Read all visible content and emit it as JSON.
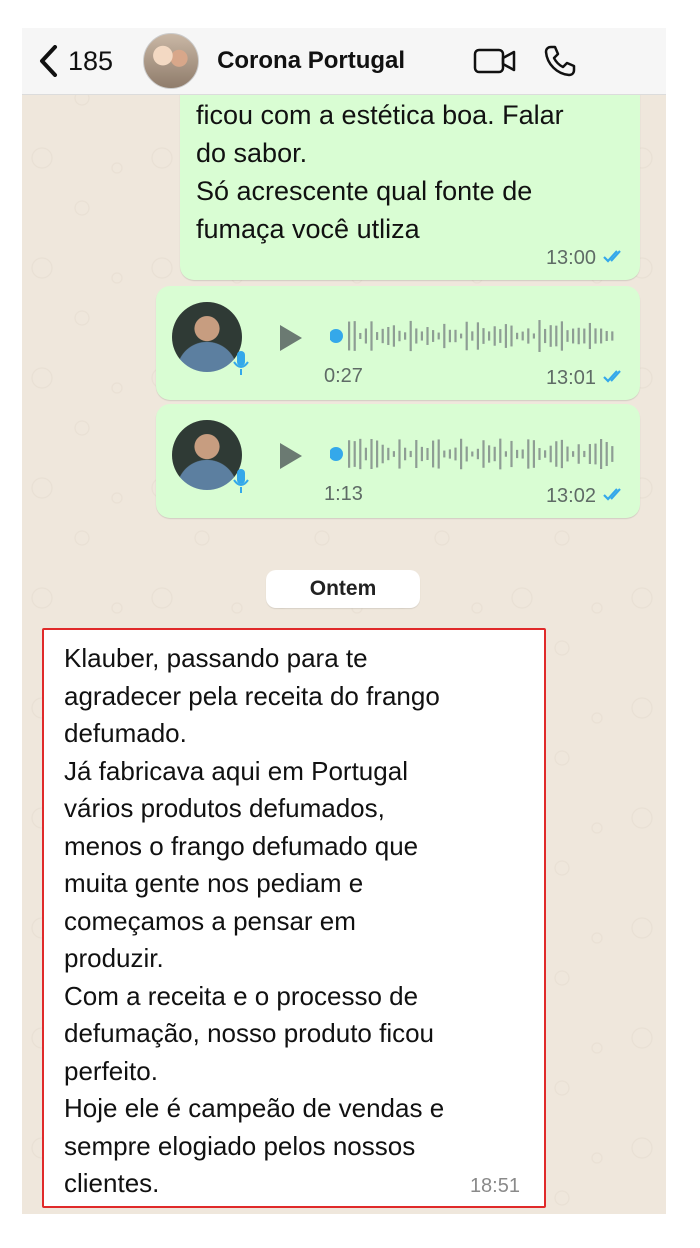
{
  "header": {
    "back_count": "185",
    "title": "Corona Portugal"
  },
  "messages": {
    "sent_text": {
      "text": "defumar deu certo e o produto\nficou com a estética boa. Falar\ndo sabor.\nSó acrescente qual fonte de\nfumaça você utliza",
      "time": "13:00"
    },
    "voice1": {
      "duration": "0:27",
      "time": "13:01"
    },
    "voice2": {
      "duration": "1:13",
      "time": "13:02"
    },
    "date_separator": "Ontem",
    "received": {
      "text": "Klauber, passando para te\nagradecer pela receita do frango\ndefumado.\nJá fabricava aqui em Portugal\nvários produtos defumados,\nmenos o frango defumado que\nmuita gente nos pediam e\ncomeçamos a pensar em\nproduzir.\nCom a receita e o processo de\ndefumação, nosso produto ficou\nperfeito.\nHoje ele é campeão de vendas e\nsempre elogiado pelos nossos\nclientes.",
      "time": "18:51"
    }
  },
  "colors": {
    "sent_bubble": "#d9fdd3",
    "received_bubble": "#ffffff",
    "tick_blue": "#34a8ea",
    "highlight_border": "#e02a2a"
  },
  "icons": [
    "back-chevron-icon",
    "video-call-icon",
    "phone-call-icon",
    "play-icon",
    "mic-icon",
    "double-check-icon"
  ]
}
